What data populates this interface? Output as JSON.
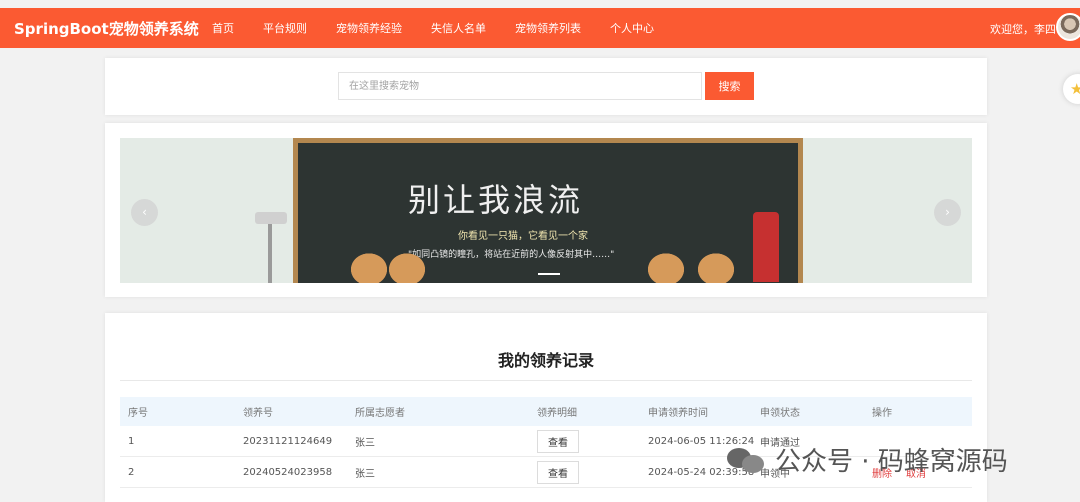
{
  "header": {
    "brand": "SpringBoot宠物领养系统",
    "nav": [
      "首页",
      "平台规则",
      "宠物领养经验",
      "失信人名单",
      "宠物领养列表",
      "个人中心"
    ],
    "welcome": "欢迎您，李四"
  },
  "search": {
    "placeholder": "在这里搜索宠物",
    "button": "搜索"
  },
  "banner": {
    "title": "别让我浪流",
    "subtitle": "你看见一只猫，它看见一个家",
    "tagline": "\"如同凸镜的瞳孔，将站在近前的人像反射其中……\"",
    "prev_icon": "chevron-left-icon",
    "next_icon": "chevron-right-icon"
  },
  "records": {
    "title": "我的领养记录",
    "columns": [
      "序号",
      "领养号",
      "所属志愿者",
      "领养明细",
      "申请领养时间",
      "申领状态",
      "操作"
    ],
    "rows": [
      {
        "index": "1",
        "no": "20231121124649",
        "volunteer": "张三",
        "detail": "查看",
        "time": "2024-06-05 11:26:24",
        "status": "申请通过",
        "ops": []
      },
      {
        "index": "2",
        "no": "20240524023958",
        "volunteer": "张三",
        "detail": "查看",
        "time": "2024-05-24 02:39:58",
        "status": "申领中",
        "ops": [
          "删除",
          "取消"
        ]
      }
    ]
  },
  "watermark": "公众号 · 码蜂窝源码",
  "colors": {
    "accent": "#fb5a32",
    "table_head": "#eef6fd",
    "danger": "#e03c3c"
  }
}
